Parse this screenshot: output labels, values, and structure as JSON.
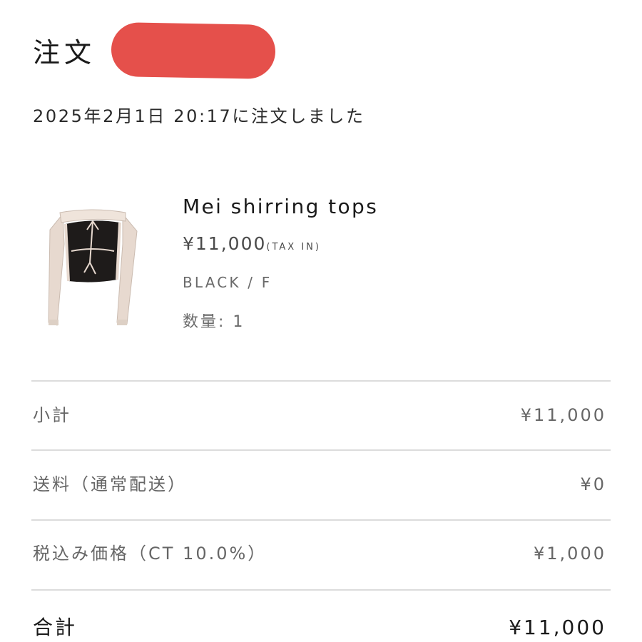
{
  "header": {
    "title": "注文",
    "redacted": true,
    "order_date": "2025年2月1日 20:17に注文しました"
  },
  "item": {
    "image_icon": "product-photo-shirring-top",
    "name": "Mei shirring tops",
    "price": "¥11,000",
    "tax_note": "(TAX IN)",
    "variant": "BLACK / F",
    "quantity": "数量: 1"
  },
  "summary": {
    "subtotal_label": "小計",
    "subtotal_value": "¥11,000",
    "shipping_label": "送料（通常配送）",
    "shipping_value": "¥0",
    "tax_label": "税込み価格（CT 10.0%）",
    "tax_value": "¥1,000",
    "total_label": "合計",
    "total_value": "¥11,000"
  },
  "colors": {
    "redaction": "#e5504b",
    "divider": "#dcdcdc",
    "text_primary": "#1a1a1a",
    "text_muted": "#666666"
  }
}
